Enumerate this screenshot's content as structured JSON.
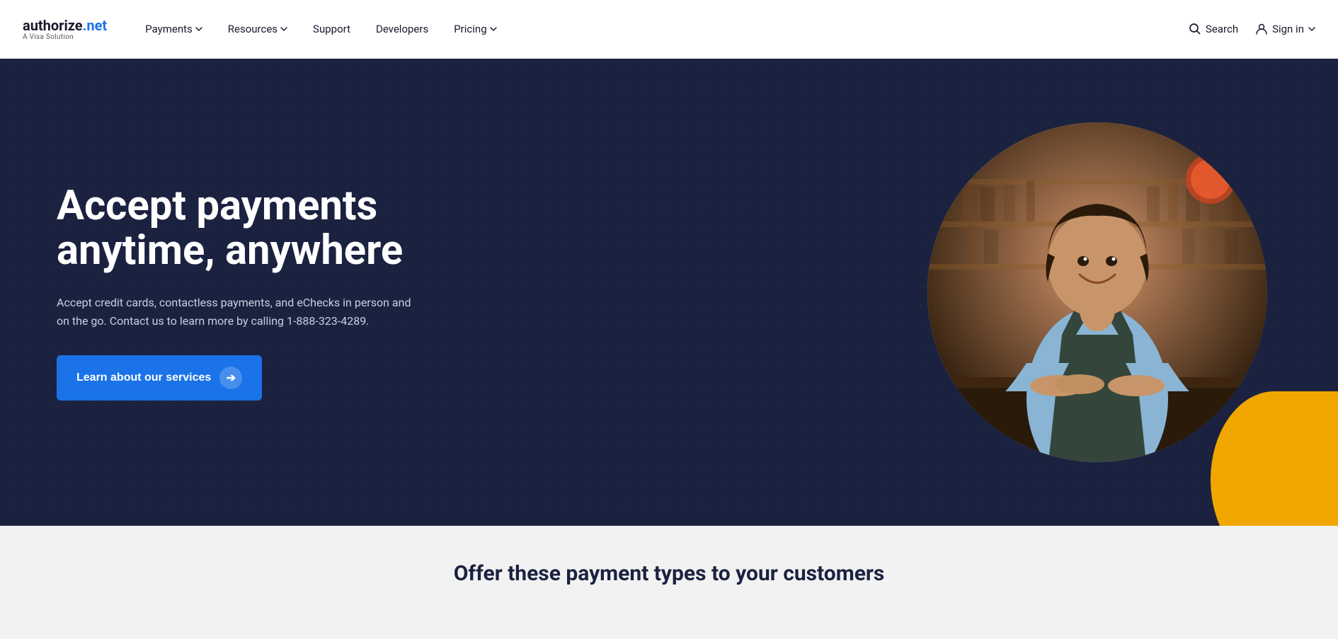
{
  "brand": {
    "name_part1": "authorize",
    "name_dot": ".",
    "name_part2": "net",
    "tagline": "A Visa Solution"
  },
  "nav": {
    "links": [
      {
        "label": "Payments",
        "has_dropdown": true
      },
      {
        "label": "Resources",
        "has_dropdown": true
      },
      {
        "label": "Support",
        "has_dropdown": false
      },
      {
        "label": "Developers",
        "has_dropdown": false
      },
      {
        "label": "Pricing",
        "has_dropdown": true
      }
    ],
    "search_label": "Search",
    "signin_label": "Sign in"
  },
  "hero": {
    "title": "Accept payments anytime, anywhere",
    "description": "Accept credit cards, contactless payments, and eChecks in person and on the go. Contact us to learn more by calling 1-888-323-4289.",
    "cta_label": "Learn about our services"
  },
  "bottom": {
    "title": "Offer these payment types to your customers"
  }
}
